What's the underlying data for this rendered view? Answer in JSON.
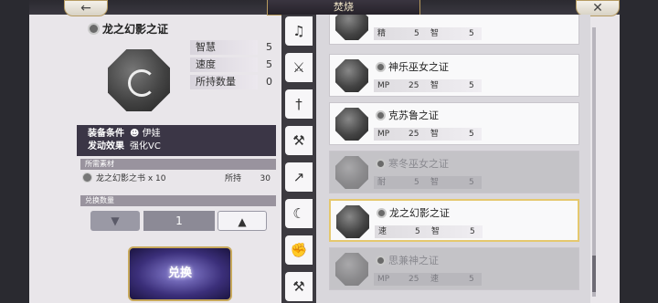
{
  "header": {
    "title": "焚烧",
    "back_icon": "back-arrow-icon",
    "close_icon": "close-x-icon"
  },
  "detail": {
    "name": "龙之幻影之证",
    "stats": [
      {
        "label": "智慧",
        "value": "5"
      },
      {
        "label": "速度",
        "value": "5"
      },
      {
        "label": "所持数量",
        "value": "0"
      }
    ],
    "equip_label": "装备条件",
    "equip_value": "伊娃",
    "effect_label": "发动效果",
    "effect_value": "强化VC",
    "materials_header": "所需素材",
    "material": {
      "name": "龙之幻影之书 x 10",
      "held_label": "所持",
      "held_value": "30"
    },
    "quantity_header": "兑换数量",
    "quantity": "1",
    "minus_symbol": "▼",
    "plus_symbol": "▲",
    "exchange_label": "兑换"
  },
  "tabs": [
    {
      "icon": "whistle-icon"
    },
    {
      "icon": "sword-icon"
    },
    {
      "icon": "dagger-icon"
    },
    {
      "icon": "axe-icon"
    },
    {
      "icon": "spear-icon"
    },
    {
      "icon": "bow-icon"
    },
    {
      "icon": "gauntlet-icon"
    },
    {
      "icon": "hammer-icon"
    }
  ],
  "list": [
    {
      "name": "",
      "s1": "精",
      "v1": "5",
      "s2": "智",
      "v2": "5",
      "dim": false,
      "selected": false
    },
    {
      "name": "神乐巫女之证",
      "s1": "MP",
      "v1": "25",
      "s2": "智",
      "v2": "5",
      "dim": false,
      "selected": false
    },
    {
      "name": "克苏鲁之证",
      "s1": "MP",
      "v1": "25",
      "s2": "智",
      "v2": "5",
      "dim": false,
      "selected": false
    },
    {
      "name": "寒冬巫女之证",
      "s1": "耐",
      "v1": "5",
      "s2": "智",
      "v2": "5",
      "dim": true,
      "selected": false
    },
    {
      "name": "龙之幻影之证",
      "s1": "速",
      "v1": "5",
      "s2": "智",
      "v2": "5",
      "dim": false,
      "selected": true
    },
    {
      "name": "思兼神之证",
      "s1": "MP",
      "v1": "25",
      "s2": "速",
      "v2": "5",
      "dim": true,
      "selected": false
    }
  ]
}
